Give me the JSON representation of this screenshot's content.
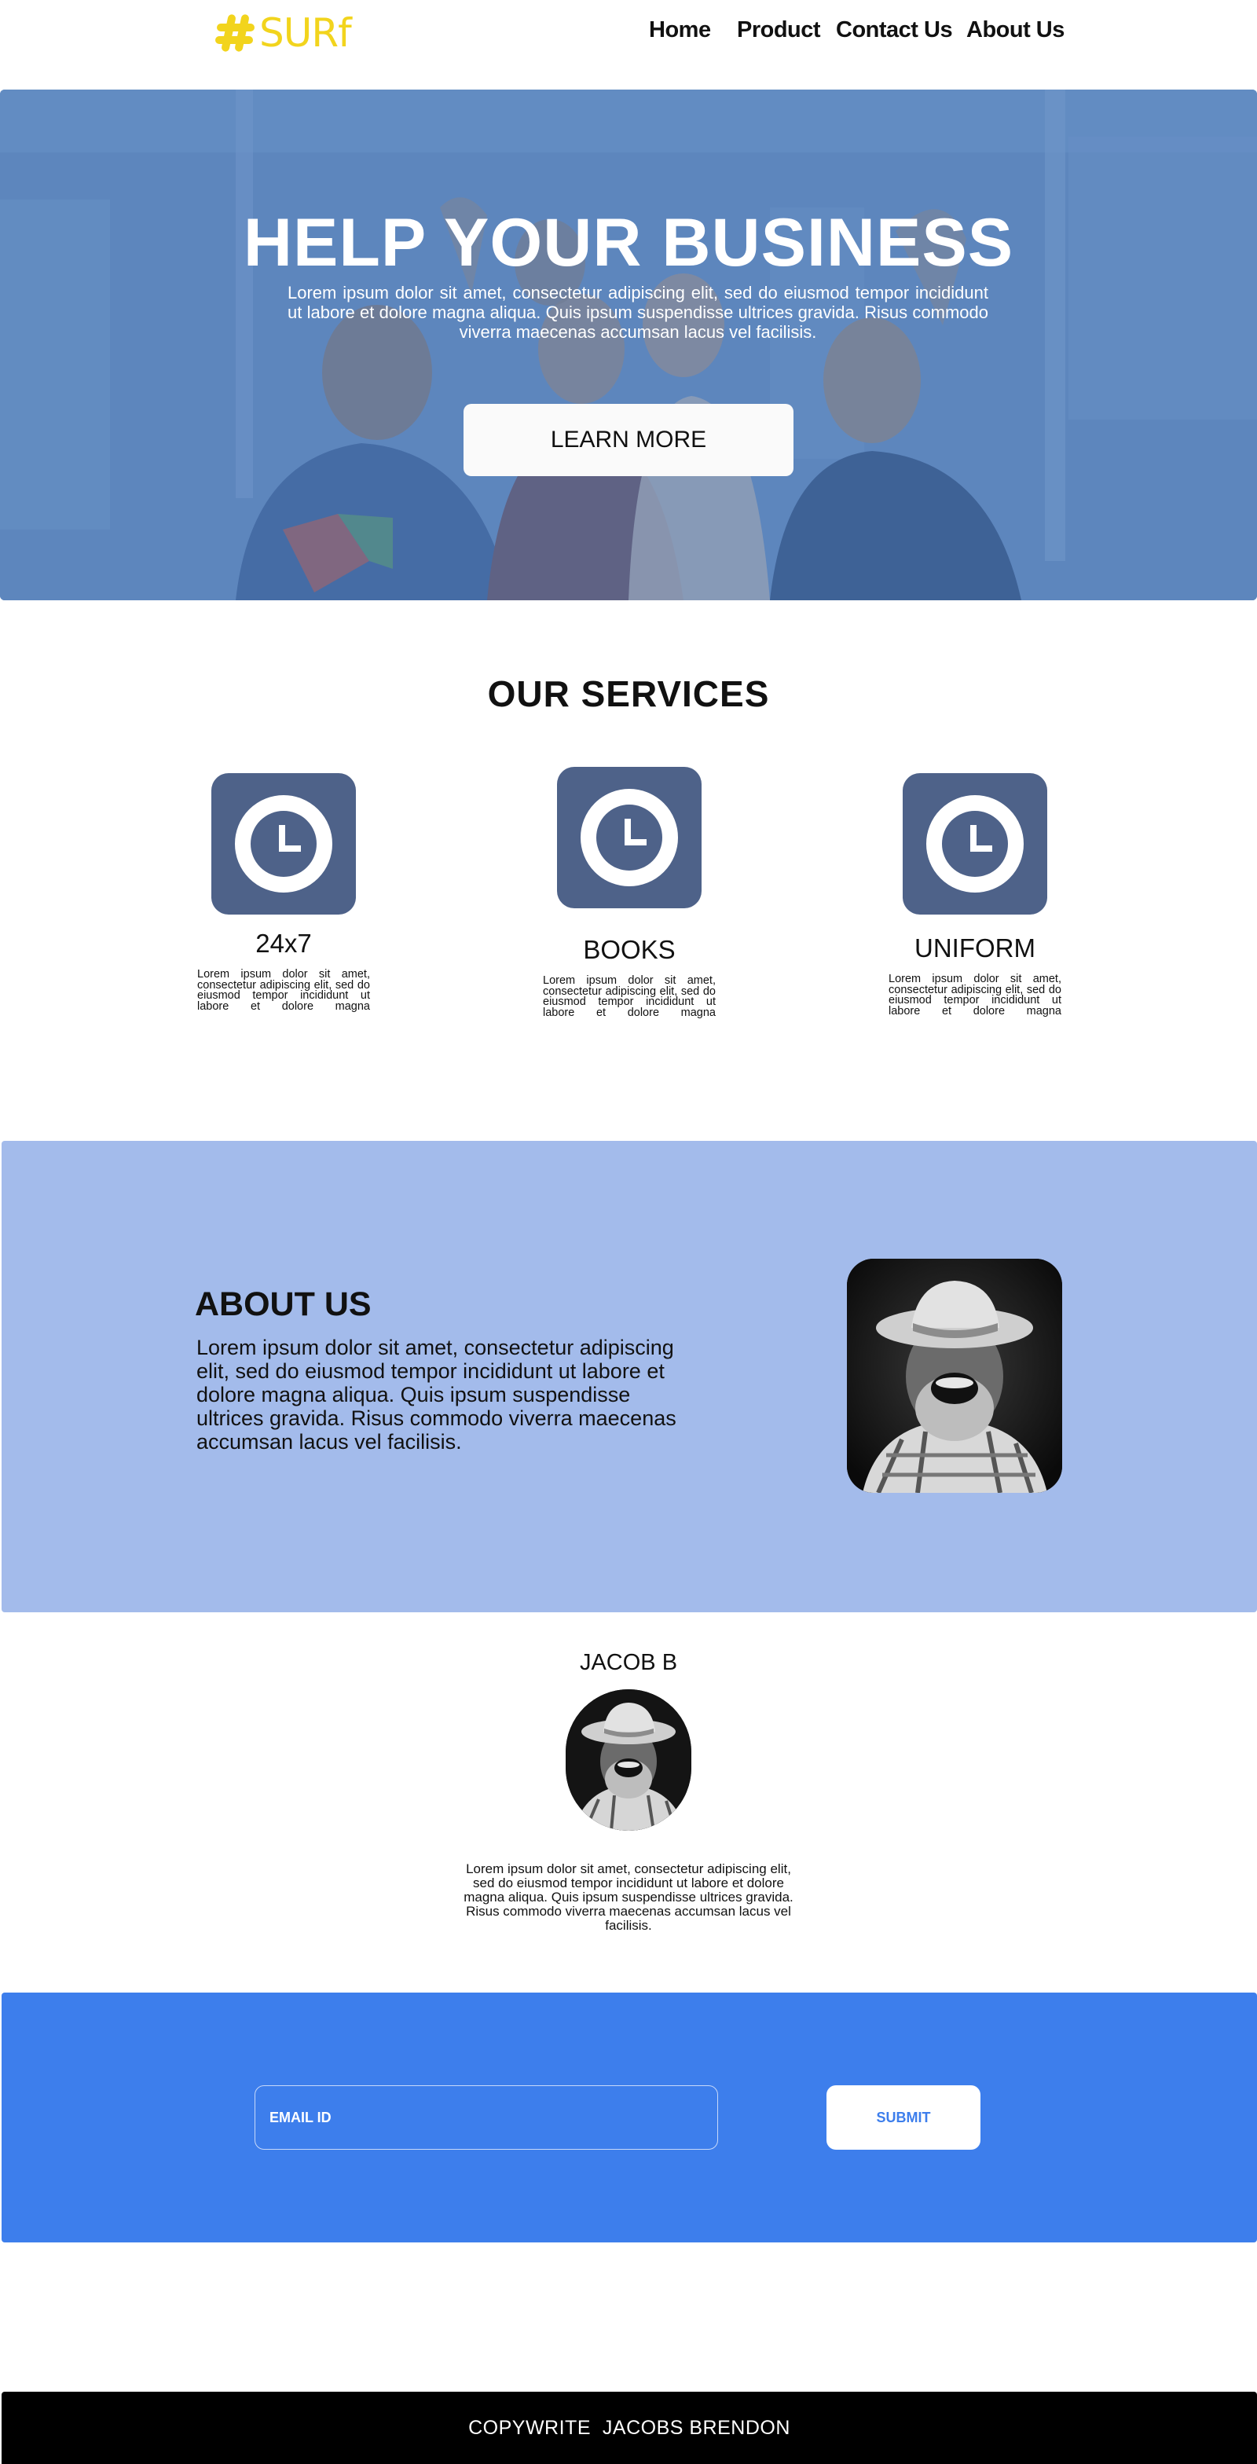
{
  "brand": {
    "logo_text": "SURf",
    "logo_color": "#f2d41d",
    "logo_icon": "hashtag-icon"
  },
  "nav": {
    "items": [
      {
        "label": "Home"
      },
      {
        "label": "Product"
      },
      {
        "label": "Contact Us"
      },
      {
        "label": "About  Us"
      }
    ]
  },
  "hero": {
    "title": "HELP YOUR  BUSINESS",
    "subtitle": "Lorem ipsum dolor sit amet, consectetur adipiscing elit, sed do eiusmod tempor incididunt ut labore et dolore magna aliqua. Quis ipsum suspendisse ultrices gravida. Risus commodo viverra maecenas accumsan lacus vel facilisis.",
    "button_label": "LEARN MORE",
    "overlay_color": "#5c83b8"
  },
  "services": {
    "title": "OUR  SERVICES",
    "tile_color": "#4e6289",
    "items": [
      {
        "name": "24x7",
        "icon": "clock-icon",
        "text": "Lorem ipsum dolor sit amet, consectetur adipiscing elit, sed do eiusmod tempor incididunt ut labore et dolore magna"
      },
      {
        "name": "BOOKS",
        "icon": "clock-icon",
        "text": "Lorem ipsum dolor sit amet, consectetur adipiscing elit, sed do eiusmod tempor incididunt ut labore et dolore magna"
      },
      {
        "name": "UNIFORM",
        "icon": "clock-icon",
        "text": "Lorem ipsum dolor sit amet, consectetur adipiscing elit, sed do eiusmod tempor incididunt ut labore et dolore magna"
      }
    ]
  },
  "about": {
    "title": "ABOUT US",
    "text": "Lorem ipsum dolor sit amet, consectetur adipiscing elit, sed do eiusmod tempor incididunt ut labore et dolore magna aliqua. Quis ipsum suspendisse ultrices gravida. Risus commodo viverra maecenas accumsan lacus vel facilisis.",
    "background": "#a3bbeb"
  },
  "testimonial": {
    "name": "JACOB B",
    "text": "Lorem ipsum dolor sit amet, consectetur adipiscing elit, sed do eiusmod tempor incididunt ut labore et dolore magna aliqua. Quis ipsum suspendisse ultrices gravida. Risus commodo viverra maecenas accumsan lacus vel facilisis."
  },
  "newsletter": {
    "email_placeholder": "EMAIL ID",
    "submit_label": "SUBMIT",
    "background": "#3d7eec"
  },
  "footer": {
    "text": "COPYWRITE  JACOBS BRENDON"
  }
}
